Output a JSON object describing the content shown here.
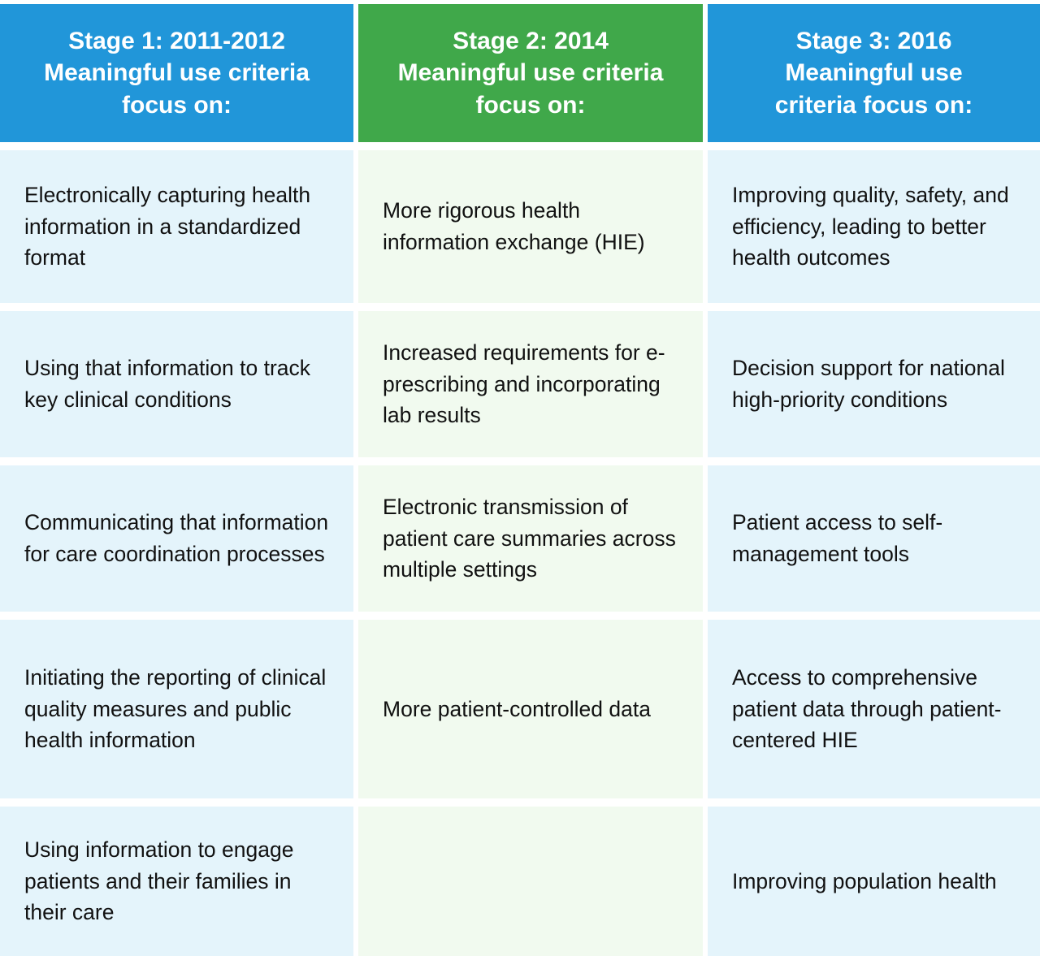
{
  "table": {
    "columns": [
      {
        "id": "stage-1",
        "header_color": "#2196d9",
        "body_color": "#e4f4fb",
        "header_lines": [
          "Stage 1: 2011-2012",
          "Meaningful use criteria",
          "focus on:"
        ],
        "header_text": "Stage 1: 2011-2012 Meaningful use criteria focus on:",
        "cells": [
          "Electronically capturing health information in a standardized format",
          "Using that information to track key clinical conditions",
          "Communicating that information for care coordination processes",
          "Initiating the reporting of clinical quality measures and public health information",
          "Using information to engage patients and their families in their care"
        ]
      },
      {
        "id": "stage-2",
        "header_color": "#40a84a",
        "body_color": "#f1faef",
        "header_lines": [
          "Stage 2: 2014",
          "Meaningful use criteria",
          "focus on:"
        ],
        "header_text": "Stage 2: 2014 Meaningful use criteria focus on:",
        "cells": [
          "More rigorous health information exchange (HIE)",
          "Increased requirements for e-prescribing and incorporating lab results",
          "Electronic transmission of patient care summaries across multiple settings",
          "More patient-controlled data",
          ""
        ]
      },
      {
        "id": "stage-3",
        "header_color": "#2196d9",
        "body_color": "#e4f4fb",
        "header_lines": [
          "Stage 3: 2016",
          "Meaningful use",
          "criteria focus on:"
        ],
        "header_text": "Stage 3: 2016 Meaningful use criteria focus on:",
        "cells": [
          "Improving quality, safety, and efficiency, leading to better health outcomes",
          "Decision support for national high-priority conditions",
          "Patient access to self-management tools",
          "Access to comprehensive patient data through patient-centered HIE",
          "Improving population health"
        ]
      }
    ]
  }
}
